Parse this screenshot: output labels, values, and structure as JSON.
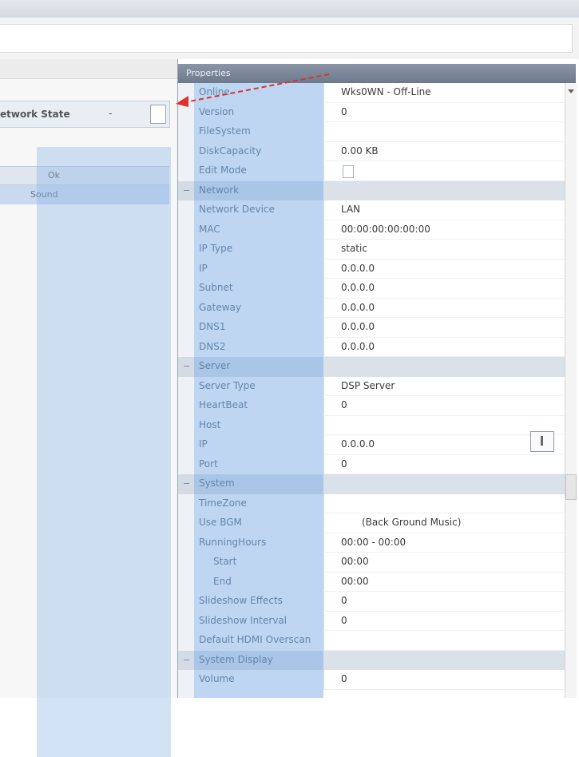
{
  "left_panel": {
    "network_state_label": "etwork State",
    "network_state_value": "-",
    "list_header_label": "Ok",
    "list_row_label": "Sound"
  },
  "property_grid": {
    "title": "Properties",
    "rows": [
      {
        "type": "prop",
        "name": "Online",
        "value": "Wks0WN - Off-Line"
      },
      {
        "type": "prop",
        "name": "Version",
        "value": "0"
      },
      {
        "type": "prop",
        "name": "FileSystem",
        "value": ""
      },
      {
        "type": "prop",
        "name": "DiskCapacity",
        "value": "0.00 KB"
      },
      {
        "type": "prop",
        "name": "Edit Mode",
        "value": ""
      },
      {
        "type": "cat",
        "name": "Network",
        "value": ""
      },
      {
        "type": "prop",
        "name": "Network Device",
        "value": "LAN"
      },
      {
        "type": "prop",
        "name": "MAC",
        "value": "00:00:00:00:00:00"
      },
      {
        "type": "prop",
        "name": "IP Type",
        "value": "static"
      },
      {
        "type": "prop",
        "name": "IP",
        "value": "0.0.0.0"
      },
      {
        "type": "prop",
        "name": "Subnet",
        "value": "0.0.0.0"
      },
      {
        "type": "prop",
        "name": "Gateway",
        "value": "0.0.0.0"
      },
      {
        "type": "prop",
        "name": "DNS1",
        "value": "0.0.0.0"
      },
      {
        "type": "prop",
        "name": "DNS2",
        "value": "0.0.0.0"
      },
      {
        "type": "cat",
        "name": "Server",
        "value": ""
      },
      {
        "type": "prop",
        "name": "Server Type",
        "value": "DSP Server"
      },
      {
        "type": "prop",
        "name": "HeartBeat",
        "value": "0"
      },
      {
        "type": "prop",
        "name": "Host",
        "value": ""
      },
      {
        "type": "prop",
        "name": "IP",
        "value": "0.0.0.0"
      },
      {
        "type": "prop",
        "name": "Port",
        "value": "0"
      },
      {
        "type": "cat",
        "name": "System",
        "value": ""
      },
      {
        "type": "prop",
        "name": "TimeZone",
        "value": ""
      },
      {
        "type": "prop",
        "name": "Use BGM",
        "value": "(Back Ground Music)"
      },
      {
        "type": "prop",
        "name": "RunningHours",
        "value": "00:00 - 00:00"
      },
      {
        "type": "sub",
        "name": "Start",
        "value": "00:00"
      },
      {
        "type": "sub",
        "name": "End",
        "value": "00:00"
      },
      {
        "type": "prop",
        "name": "Slideshow Effects",
        "value": "0"
      },
      {
        "type": "prop",
        "name": "Slideshow Interval",
        "value": "0"
      },
      {
        "type": "prop",
        "name": "Default HDMI Overscan",
        "value": ""
      },
      {
        "type": "cat",
        "name": "System Display",
        "value": ""
      },
      {
        "type": "prop",
        "name": "Volume",
        "value": "0"
      }
    ]
  }
}
